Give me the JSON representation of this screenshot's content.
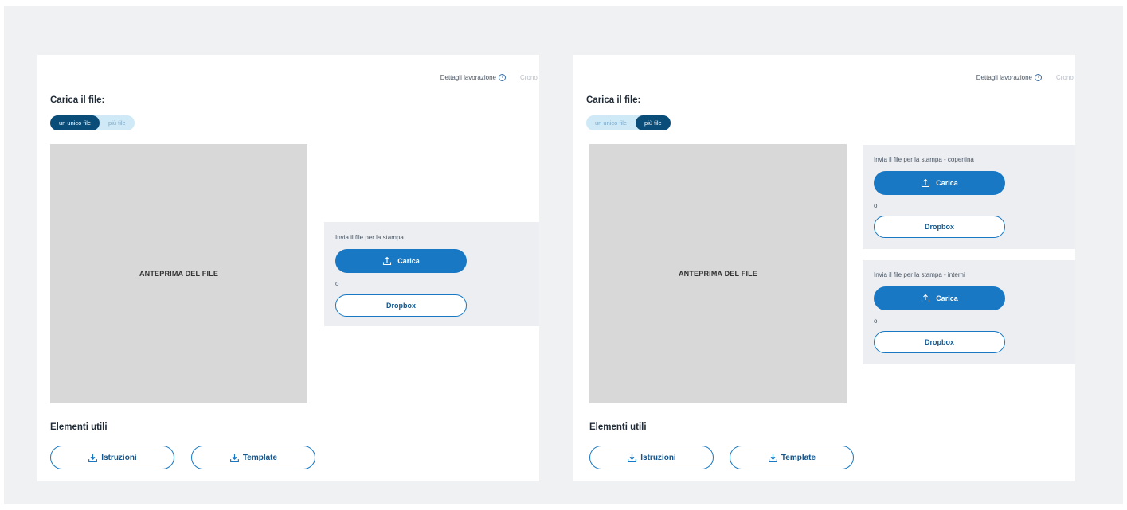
{
  "header": {
    "details_link": "Dettagli lavorazione",
    "info_glyph": "i",
    "faded_link": "Cronol"
  },
  "upload": {
    "title": "Carica il file:",
    "toggle": {
      "single": "un unico file",
      "multiple": "più file"
    },
    "preview_label": "ANTEPRIMA DEL FILE",
    "or_label": "o",
    "carica_label": "Carica",
    "dropbox_label": "Dropbox"
  },
  "left_panel": {
    "active_toggle": "single",
    "upload_box": {
      "label": "Invia il file per la stampa"
    }
  },
  "right_panel": {
    "active_toggle": "multiple",
    "upload_boxes": [
      {
        "label": "Invia il file per la stampa - copertina"
      },
      {
        "label": "Invia il file per la stampa - interni"
      }
    ]
  },
  "useful": {
    "title": "Elementi utili",
    "instructions_label": "Istruzioni",
    "template_label": "Template"
  },
  "icons": {
    "upload": "upload-icon",
    "download": "download-icon",
    "info": "info-icon"
  },
  "colors": {
    "primary_blue": "#1878c4",
    "dark_navy": "#0b4d79",
    "toggle_bg": "#cfe9f7",
    "preview_gray": "#d8d8d8",
    "upload_box_bg": "#eceef2",
    "page_bg": "#f0f1f3"
  }
}
